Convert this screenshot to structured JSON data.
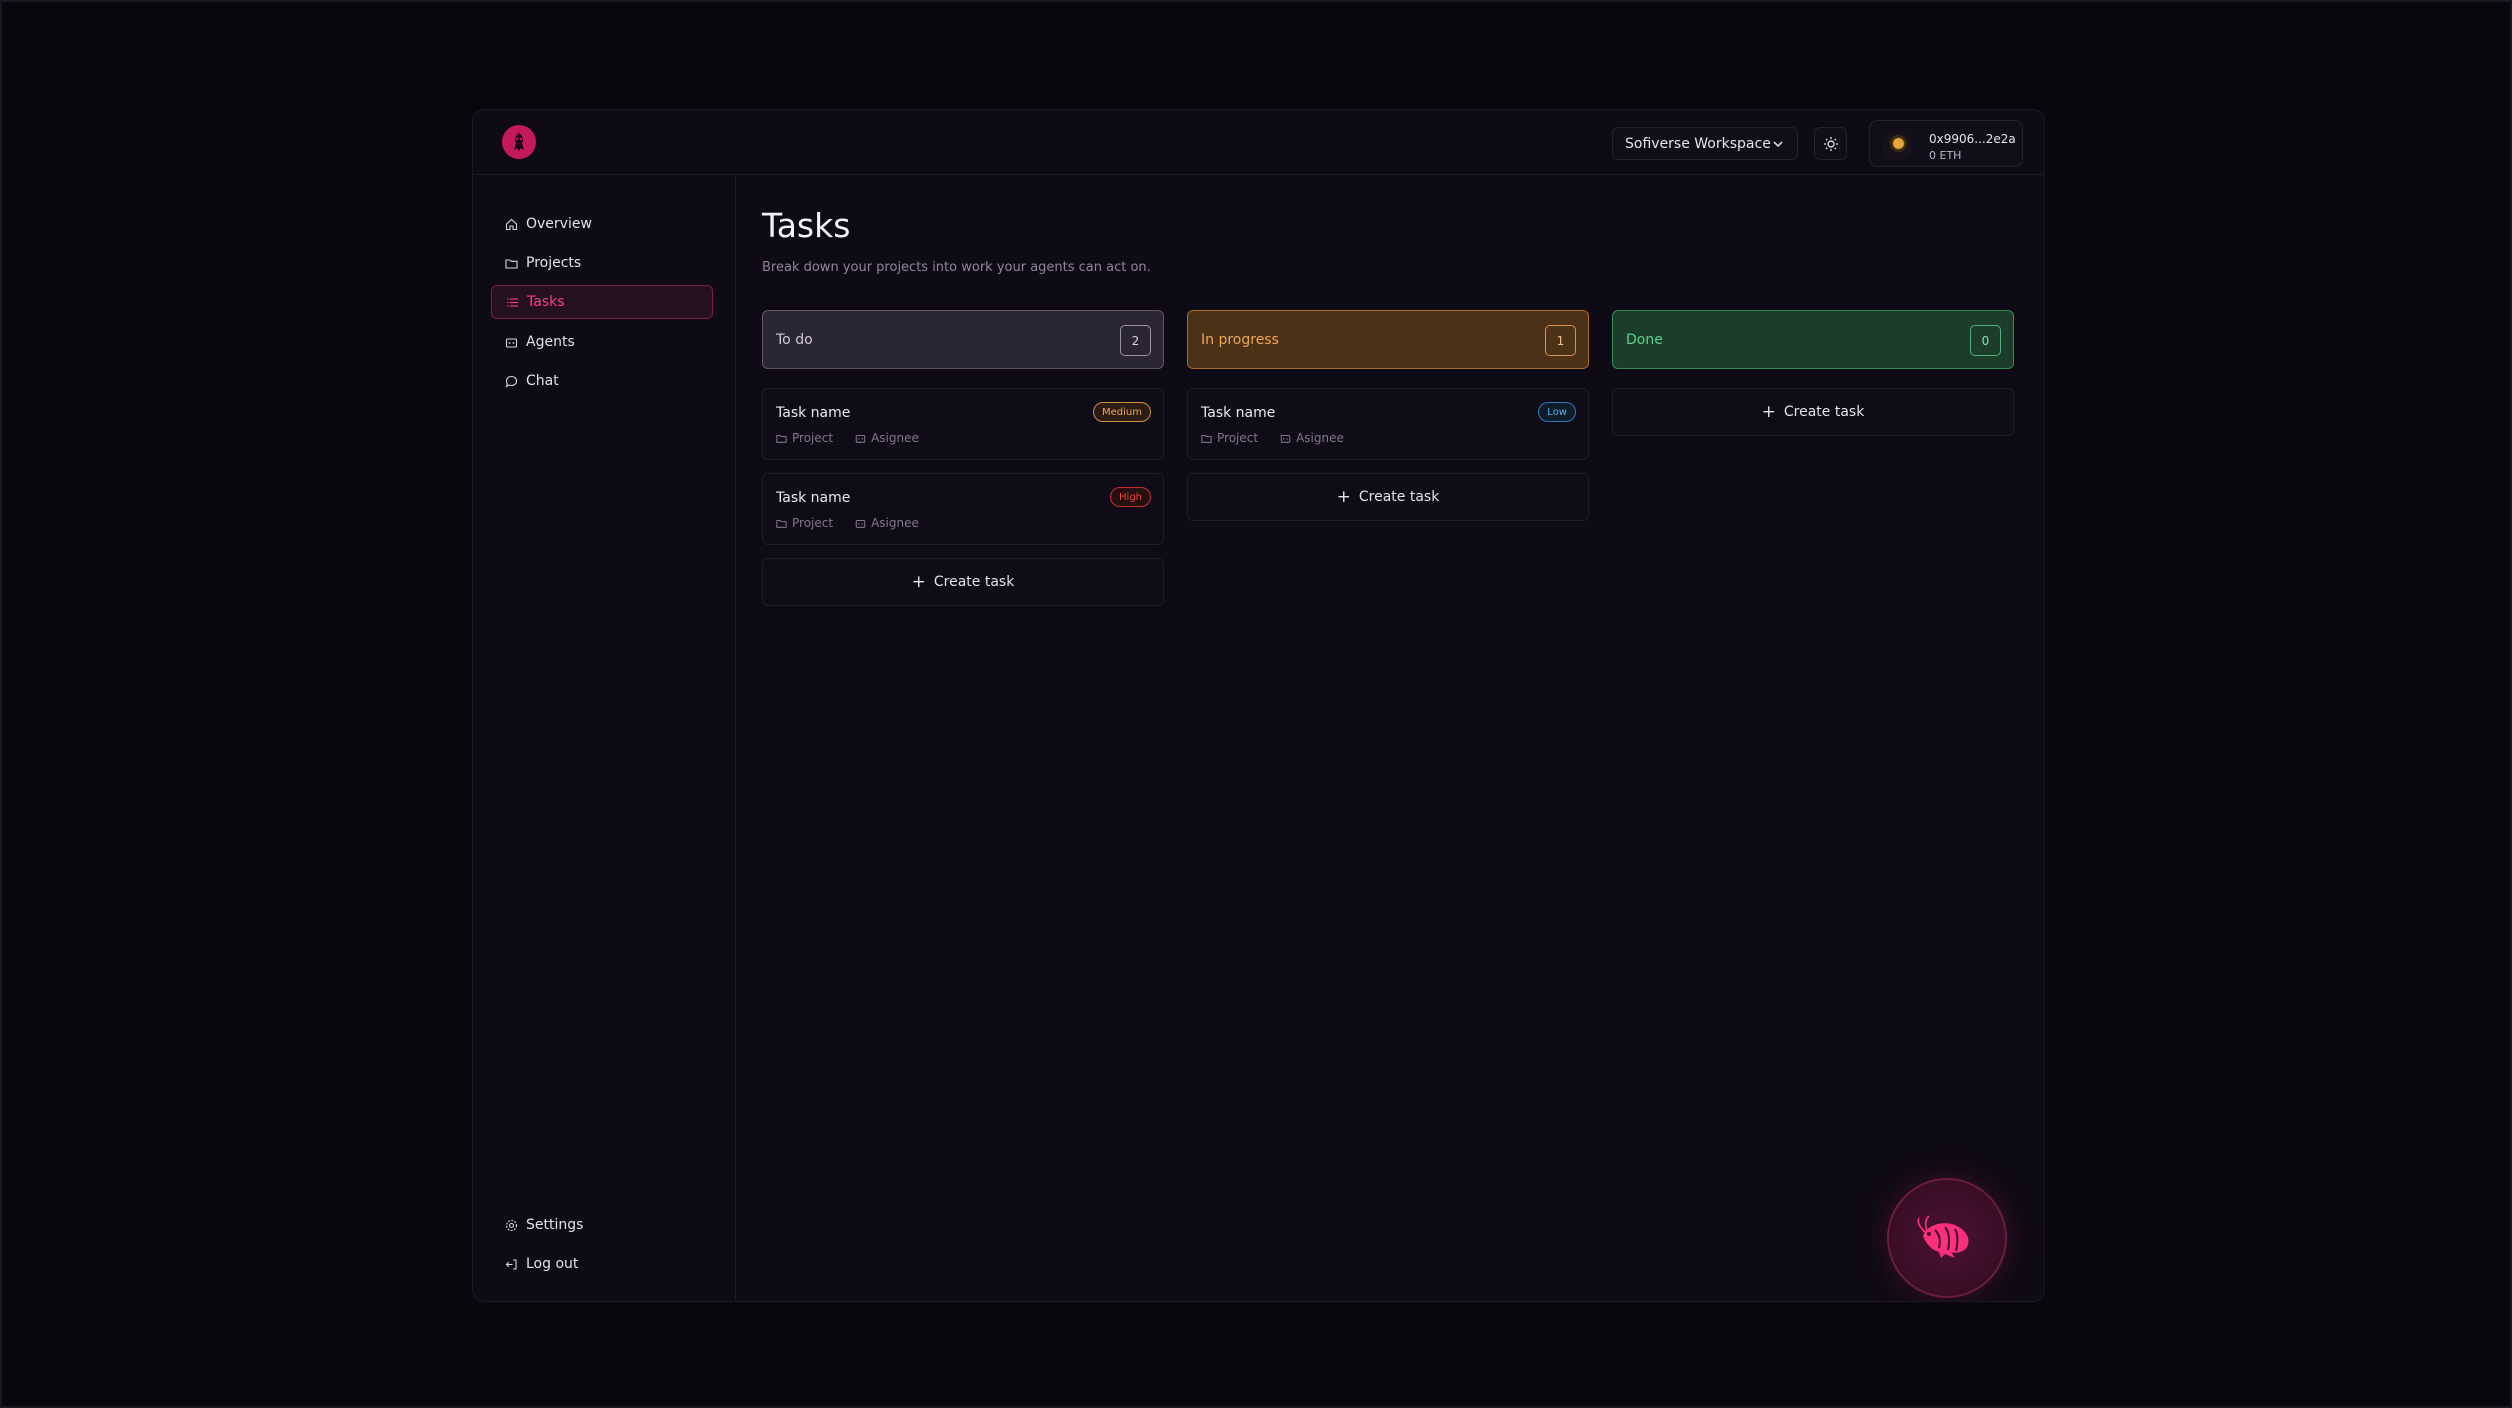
{
  "workspace": {
    "selected": "Sofiverse Workspace"
  },
  "wallet": {
    "address": "0x9906...2e2a",
    "balance": "0 ETH"
  },
  "sidebar": {
    "items": [
      {
        "label": "Overview",
        "icon": "home-icon"
      },
      {
        "label": "Projects",
        "icon": "folder-icon"
      },
      {
        "label": "Tasks",
        "icon": "list-icon",
        "active": true
      },
      {
        "label": "Agents",
        "icon": "bot-icon"
      },
      {
        "label": "Chat",
        "icon": "chat-icon"
      }
    ],
    "bottom": [
      {
        "label": "Settings",
        "icon": "gear-icon"
      },
      {
        "label": "Log out",
        "icon": "logout-icon"
      }
    ]
  },
  "page": {
    "title": "Tasks",
    "subtitle": "Break down your projects into work your agents can act on."
  },
  "columns": [
    {
      "title": "To do",
      "count": "2",
      "tasks": [
        {
          "name": "Task name",
          "priority": "Medium",
          "project": "Project",
          "assignee": "Asignee"
        },
        {
          "name": "Task name",
          "priority": "High",
          "project": "Project",
          "assignee": "Asignee"
        }
      ],
      "create_label": "Create task"
    },
    {
      "title": "In progress",
      "count": "1",
      "tasks": [
        {
          "name": "Task name",
          "priority": "Low",
          "project": "Project",
          "assignee": "Asignee"
        }
      ],
      "create_label": "Create task"
    },
    {
      "title": "Done",
      "count": "0",
      "tasks": [],
      "create_label": "Create task"
    }
  ],
  "colors": {
    "accent": "#ff3d8a",
    "todo": "#2b2633",
    "in_progress": "#4b3216",
    "done": "#1c3d2a",
    "priority_medium": "#f0a45b",
    "priority_high": "#f0413d",
    "priority_low": "#63aee8"
  }
}
